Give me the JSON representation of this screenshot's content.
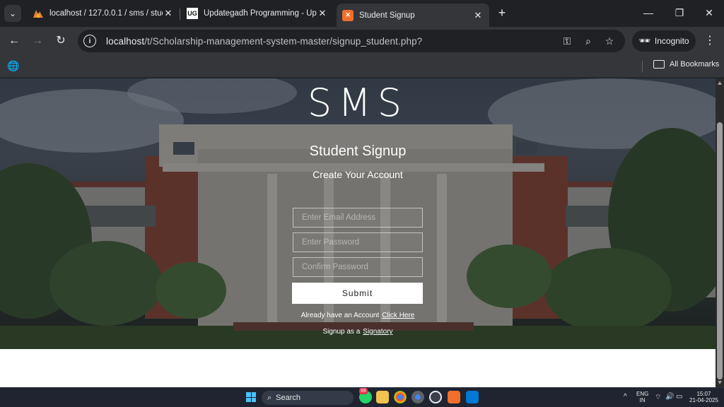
{
  "colors": {
    "accent": "#4cc2ff",
    "chrome_dark": "#202124",
    "chrome_mid": "#35363a"
  },
  "browser": {
    "tabs": [
      {
        "title": "localhost / 127.0.0.1 / sms / studen",
        "icon": "phpmyadmin-icon",
        "active": false
      },
      {
        "title": "Updategadh Programming - Upda",
        "icon": "updategadh-icon",
        "active": false
      },
      {
        "title": "Student Signup",
        "icon": "xampp-icon",
        "active": true
      }
    ],
    "new_tab": "+",
    "url_host": "localhost",
    "url_path": "/t/Scholarship-management-system-master/signup_student.php?",
    "incognito_label": "Incognito",
    "all_bookmarks": "All Bookmarks"
  },
  "page": {
    "brand": "SMS",
    "heading": "Student Signup",
    "subheading": "Create Your Account",
    "email_placeholder": "Enter Email Address",
    "password_placeholder": "Enter Password",
    "confirm_placeholder": "Confirm Password",
    "submit_label": "Submit",
    "login_text": "Already have an Account",
    "login_link": "Click Here",
    "signatory_text": "Signup as a",
    "signatory_link": "Signatory"
  },
  "taskbar": {
    "search_label": "Search",
    "notification_count": "99",
    "lang_top": "ENG",
    "lang_bottom": "IN",
    "time": "15:07",
    "date": "21-04-2025"
  }
}
